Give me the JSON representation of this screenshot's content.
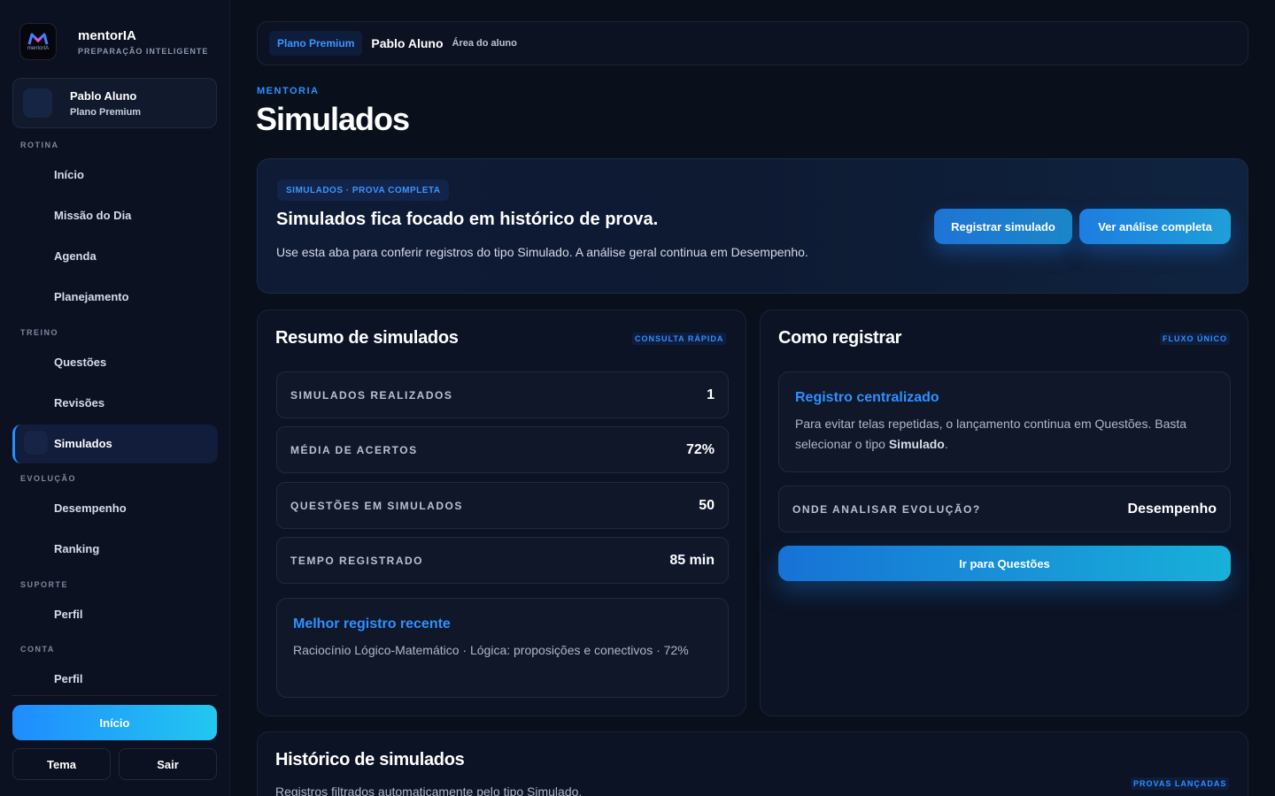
{
  "brand": {
    "name": "mentorIA",
    "tagline": "PREPARAÇÃO INTELIGENTE",
    "logo_text": "mentorIA"
  },
  "user": {
    "name": "Pablo Aluno",
    "plan": "Plano Premium"
  },
  "nav": {
    "sections": [
      {
        "label": "ROTINA",
        "items": [
          "Início",
          "Missão do Dia",
          "Agenda",
          "Planejamento"
        ]
      },
      {
        "label": "TREINO",
        "items": [
          "Questões",
          "Revisões",
          "Simulados"
        ]
      },
      {
        "label": "EVOLUÇÃO",
        "items": [
          "Desempenho",
          "Ranking"
        ]
      },
      {
        "label": "SUPORTE",
        "items": [
          "Perfil"
        ]
      },
      {
        "label": "CONTA",
        "items": [
          "Perfil"
        ]
      }
    ],
    "active": "Simulados"
  },
  "sidebar_actions": {
    "home": "Início",
    "theme": "Tema",
    "logout": "Sair"
  },
  "topbar": {
    "plan_badge": "Plano Premium",
    "name": "Pablo Aluno",
    "area": "Área do aluno"
  },
  "page": {
    "eyebrow": "MENTORIA",
    "title": "Simulados"
  },
  "hero": {
    "chip": "SIMULADOS · PROVA COMPLETA",
    "title": "Simulados fica focado em histórico de prova.",
    "description": "Use esta aba para conferir registros do tipo Simulado. A análise geral continua em Desempenho.",
    "primary_button": "Registrar simulado",
    "secondary_button": "Ver análise completa"
  },
  "summary": {
    "title": "Resumo de simulados",
    "tag": "CONSULTA RÁPIDA",
    "stats": [
      {
        "label": "SIMULADOS REALIZADOS",
        "value": "1"
      },
      {
        "label": "MÉDIA DE ACERTOS",
        "value": "72%"
      },
      {
        "label": "QUESTÕES EM SIMULADOS",
        "value": "50"
      },
      {
        "label": "TEMPO REGISTRADO",
        "value": "85 min"
      }
    ],
    "best": {
      "title": "Melhor registro recente",
      "text": "Raciocínio Lógico-Matemático · Lógica: proposições e conectivos · 72%"
    }
  },
  "how_to": {
    "title": "Como registrar",
    "tag": "FLUXO ÚNICO",
    "box_title": "Registro centralizado",
    "box_text_1": "Para evitar telas repetidas, o lançamento continua em Questões. Basta selecionar o tipo ",
    "box_text_bold": "Simulado",
    "box_text_2": ".",
    "where_label": "ONDE ANALISAR EVOLUÇÃO?",
    "where_value": "Desempenho",
    "cta": "Ir para Questões"
  },
  "history": {
    "title": "Histórico de simulados",
    "subtitle": "Registros filtrados automaticamente pelo tipo Simulado.",
    "tag": "PROVAS LANÇADAS"
  },
  "colors": {
    "accent": "#2e90ff",
    "background": "#0a0f1c",
    "cyan": "#22c7f0"
  }
}
